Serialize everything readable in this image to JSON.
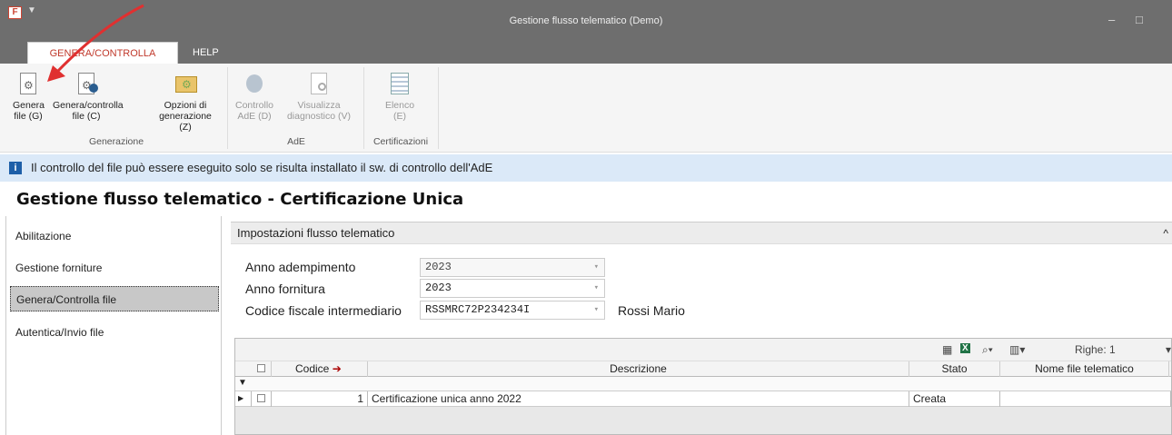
{
  "window": {
    "title": "Gestione flusso telematico  (Demo)",
    "app_icon": "F",
    "minimize": "–",
    "maximize": "□"
  },
  "tabs": {
    "active": "GENERA/CONTROLLA FILE",
    "help": "HELP"
  },
  "ribbon": {
    "groups": [
      {
        "label": "Generazione"
      },
      {
        "label": "AdE"
      },
      {
        "label": "Certificazioni"
      }
    ],
    "buttons": [
      {
        "line1": "Genera",
        "line2": "file (G)",
        "icon": "gear-doc-icon"
      },
      {
        "line1": "Genera/controlla",
        "line2": "file (C)",
        "icon": "gear-doc-check-icon"
      },
      {
        "line1": "Opzioni di",
        "line2": "generazione (Z)",
        "icon": "folder-gear-icon"
      },
      {
        "line1": "Controllo",
        "line2": "AdE (D)",
        "icon": "ade-control-icon"
      },
      {
        "line1": "Visualizza",
        "line2": "diagnostico (V)",
        "icon": "doc-search-icon"
      },
      {
        "line1": "Elenco",
        "line2": "(E)",
        "icon": "list-icon"
      }
    ]
  },
  "info": {
    "text": "Il controllo del file può essere eseguito solo se risulta installato il sw. di controllo dell'AdE",
    "icon_glyph": "i"
  },
  "page": {
    "title": "Gestione flusso telematico - Certificazione Unica"
  },
  "nav": {
    "items": [
      "Abilitazione",
      "Gestione forniture",
      "Genera/Controlla file",
      "Autentica/Invio file"
    ]
  },
  "section": {
    "title": "Impostazioni flusso telematico",
    "caret": "^"
  },
  "form": {
    "anno_adempimento": {
      "label": "Anno adempimento",
      "value": "2023"
    },
    "anno_fornitura": {
      "label": "Anno fornitura",
      "value": "2023"
    },
    "codice_fiscale": {
      "label": "Codice fiscale intermediario",
      "value": "RSSMRC72P234234I",
      "name": "Rossi Mario"
    },
    "dd_glyph": "▾"
  },
  "grid": {
    "righe": "Righe: 1",
    "columns": {
      "codice": "Codice",
      "descrizione": "Descrizione",
      "stato": "Stato",
      "nome_file": "Nome file telematico"
    },
    "rows": [
      {
        "codice": "1",
        "descrizione": "Certificazione unica anno 2022",
        "stato": "Creata",
        "nome_file": ""
      }
    ]
  }
}
